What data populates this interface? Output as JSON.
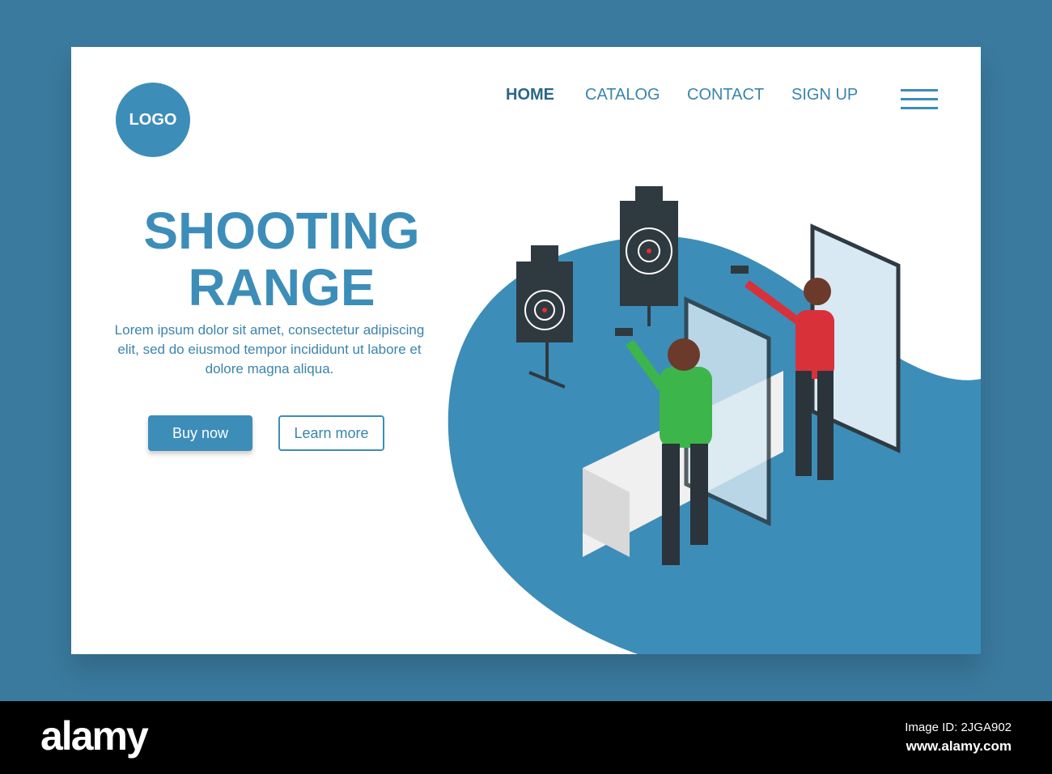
{
  "logo": "LOGO",
  "nav": {
    "items": [
      "HOME",
      "CATALOG",
      "CONTACT",
      "SIGN UP"
    ]
  },
  "hero": {
    "title_line1": "SHOOTING",
    "title_line2": "RANGE",
    "description": "Lorem ipsum dolor sit amet, consectetur adipiscing elit, sed do eiusmod tempor incididunt ut labore et dolore magna aliqua.",
    "buy_label": "Buy now",
    "learn_label": "Learn more"
  },
  "footer": {
    "brand": "alamy",
    "image_id": "Image ID: 2JGA902",
    "url": "www.alamy.com"
  },
  "colors": {
    "accent": "#3d8db9",
    "background": "#3a7a9e"
  }
}
